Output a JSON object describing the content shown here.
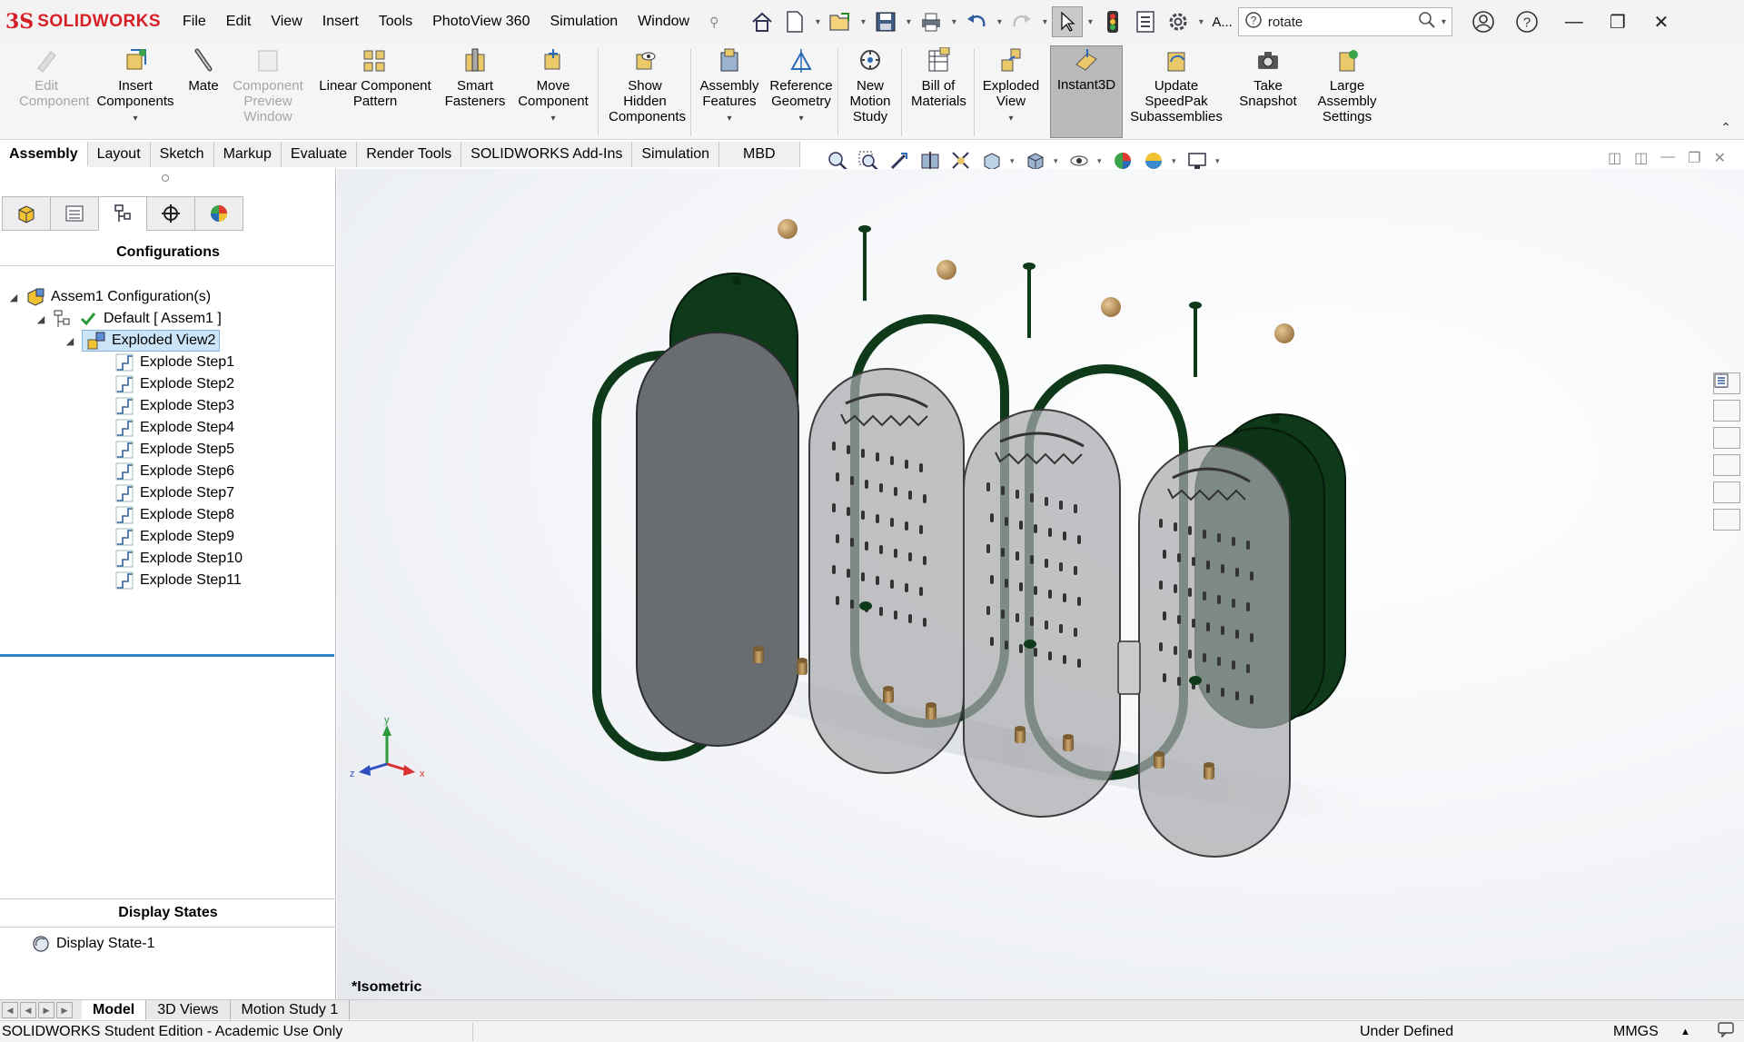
{
  "app": {
    "logo_prefix": "3S",
    "logo_text": "SOLIDWORKS"
  },
  "menu": [
    "File",
    "Edit",
    "View",
    "Insert",
    "Tools",
    "PhotoView 360",
    "Simulation",
    "Window"
  ],
  "search": {
    "value": "rotate",
    "user_label": "A..."
  },
  "ribbon": {
    "edit_component": "Edit Component",
    "insert_components": "Insert Components",
    "mate": "Mate",
    "component_preview": "Component Preview Window",
    "linear_pattern": "Linear Component Pattern",
    "smart_fasteners": "Smart Fasteners",
    "move_component": "Move Component",
    "show_hidden": "Show Hidden Components",
    "assembly_features": "Assembly Features",
    "reference_geometry": "Reference Geometry",
    "new_motion_study": "New Motion Study",
    "bill_of_materials": "Bill of Materials",
    "exploded_view": "Exploded View",
    "instant3d": "Instant3D",
    "update_speedpak": "Update SpeedPak Subassemblies",
    "take_snapshot": "Take Snapshot",
    "large_assembly": "Large Assembly Settings"
  },
  "command_tabs": [
    "Assembly",
    "Layout",
    "Sketch",
    "Markup",
    "Evaluate",
    "Render Tools",
    "SOLIDWORKS Add-Ins",
    "Simulation",
    "MBD"
  ],
  "panel": {
    "title": "Configurations",
    "root": "Assem1 Configuration(s)",
    "config": "Default [ Assem1 ]",
    "exploded": "Exploded View2",
    "steps": [
      "Explode Step1",
      "Explode Step2",
      "Explode Step3",
      "Explode Step4",
      "Explode Step5",
      "Explode Step6",
      "Explode Step7",
      "Explode Step8",
      "Explode Step9",
      "Explode Step10",
      "Explode Step11"
    ],
    "display_states_title": "Display States",
    "display_state": "Display State-1"
  },
  "viewport": {
    "view_label": "*Isometric",
    "triad": {
      "x": "x",
      "y": "y",
      "z": "z"
    }
  },
  "model_tabs": [
    "Model",
    "3D Views",
    "Motion Study 1"
  ],
  "status": {
    "left": "SOLIDWORKS Student Edition - Academic Use Only",
    "mid": "Under Defined",
    "units": "MMGS"
  },
  "colors": {
    "brand": "#d71f26",
    "part_green": "#0f3a1a",
    "selection": "#cce4f7",
    "accent_blue": "#2a84c6"
  },
  "icons": [
    "home-icon",
    "new-document-icon",
    "open-icon",
    "save-icon",
    "print-icon",
    "undo-icon",
    "redo-icon",
    "select-icon",
    "rebuild-icon",
    "file-properties-icon",
    "options-icon",
    "search-icon",
    "user-icon",
    "help-icon"
  ]
}
